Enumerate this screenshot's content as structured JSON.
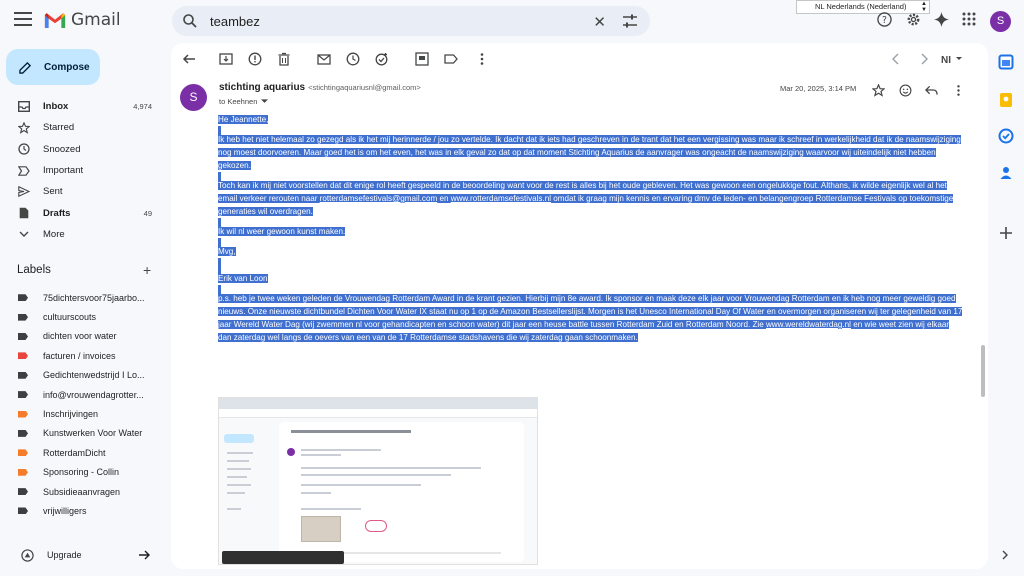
{
  "app": {
    "name": "Gmail"
  },
  "search": {
    "value": "teambez"
  },
  "language_popup": {
    "text": "NL Nederlands (Nederland)"
  },
  "account": {
    "avatar_letter": "S"
  },
  "compose": {
    "label": "Compose"
  },
  "nav": [
    {
      "label": "Inbox",
      "count": "4,974",
      "bold": true,
      "icon": "inbox-icon"
    },
    {
      "label": "Starred",
      "count": "",
      "bold": false,
      "icon": "star-icon"
    },
    {
      "label": "Snoozed",
      "count": "",
      "bold": false,
      "icon": "clock-icon"
    },
    {
      "label": "Important",
      "count": "",
      "bold": false,
      "icon": "important-icon"
    },
    {
      "label": "Sent",
      "count": "",
      "bold": false,
      "icon": "send-icon"
    },
    {
      "label": "Drafts",
      "count": "49",
      "bold": true,
      "icon": "draft-icon"
    },
    {
      "label": "More",
      "count": "",
      "bold": false,
      "icon": "chevron-down-icon"
    }
  ],
  "labels": {
    "heading": "Labels",
    "items": [
      {
        "label": "75dichtersvoor75jaarbo...",
        "color": "#3c4043"
      },
      {
        "label": "cultuurscouts",
        "color": "#3c4043"
      },
      {
        "label": "dichten voor water",
        "color": "#3c4043"
      },
      {
        "label": "facturen / invoices",
        "color": "#e8453c"
      },
      {
        "label": "Gedichtenwedstrijd I Lo...",
        "color": "#3c4043"
      },
      {
        "label": "info@vrouwendagrotter...",
        "color": "#3c4043"
      },
      {
        "label": "Inschrijvingen",
        "color": "#f57c2b"
      },
      {
        "label": "Kunstwerken Voor Water",
        "color": "#3c4043"
      },
      {
        "label": "RotterdamDicht",
        "color": "#f57c2b"
      },
      {
        "label": "Sponsoring - Collin",
        "color": "#f57c2b"
      },
      {
        "label": "Subsidieaanvragen",
        "color": "#3c4043"
      },
      {
        "label": "vrijwilligers",
        "color": "#3c4043"
      }
    ]
  },
  "upgrade": {
    "label": "Upgrade"
  },
  "message": {
    "sender_name": "stichting aquarius",
    "sender_email": "<stichtingaquariusnl@gmail.com>",
    "avatar_letter": "S",
    "to": "to Keehnen",
    "date": "Mar 20, 2025, 3:14 PM",
    "paragraphs": {
      "greeting": "He Jeannette,",
      "p1": "Ik heb het niet helemaal zo gezegd als ik het mij herinnerde / jou zo vertelde. Ik dacht dat ik iets had geschreven in de trant dat het een vergissing was maar ik schreef in werkelijkheid dat ik de naamswijziging nog moest doorvoeren. Maar goed het is om het even, het was in elk geval zo dat op dat moment Stichting Aquarius de aanvrager was ongeacht de naamswijziging waarvoor wij uiteindelijk niet hebben gekozen.",
      "p2_a": "Toch kan ik mij niet voorstellen dat dit enige rol heeft gespeeld in de beoordeling want voor de rest is alles bij het oude gebleven. Het was gewoon een ongelukkige fout. Althans, ik wilde eigenlijk wel al het email verkeer rerouten naar ",
      "p2_link1": "rotterdamsefestivals@gmail.com",
      "p2_b": " en ",
      "p2_link2": "www.rotterdamsefestivals.nl",
      "p2_c": " omdat ik graag mijn kennis en ervaring dmv de leden- en belangengroep Rotterdamse Festivals op toekomstige generaties wil overdragen.",
      "p3": "Ik wil nl weer gewoon kunst maken.",
      "p4": "Mvg,",
      "signature": "Erik van Loon",
      "ps_a": "p.s. heb je twee weken geleden de Vrouwendag Rotterdam Award in de krant gezien. Hierbij mijn 8e award. Ik sponsor en maak deze elk jaar voor Vrouwendag Rotterdam en ik heb nog meer geweldig goed nieuws. Onze nieuwste dichtbundel Dichten Voor Water IX staat nu op 1 op de Amazon Bestsellerslijst. Morgen is het Unesco International Day Of Water en overmorgen organiseren wij ter gelegenheid van 17 jaar Wereld Water Dag (wij zwemmen nl voor gehandicapten en schoon water) dit jaar een heuse battle tussen Rotterdam Zuid en Rotterdam Noord. Zie ",
      "ps_link": "www.wereldwaterdag.nl",
      "ps_b": " en wie weet zien wij elkaar dan zaterdag wel langs de oevers van een van de 17 Rotterdamse stadshavens die wij zaterdag gaan schoonmaken."
    }
  },
  "colors": {
    "selection": "#3f6fcf",
    "compose_bg": "#c2e7ff",
    "avatar": "#7b2fa6",
    "app_bg": "#f6f8fc"
  }
}
